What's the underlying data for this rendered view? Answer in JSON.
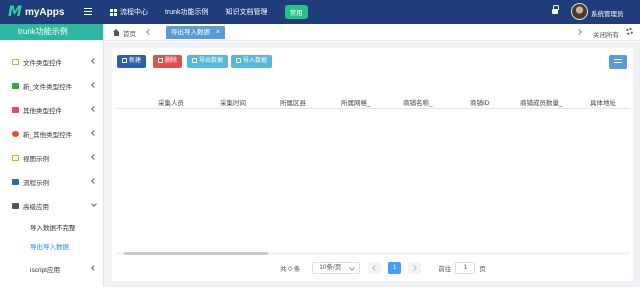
{
  "app": {
    "logo_mark": "M",
    "name": "myApps"
  },
  "topnav": {
    "items": [
      {
        "label": "流程中心"
      },
      {
        "label": "trunk功能示例"
      },
      {
        "label": "知识文档管理"
      },
      {
        "label": "常用"
      }
    ],
    "username": "系统管理员"
  },
  "sidebar": {
    "title": "trunk功能示例",
    "items": [
      {
        "label": "文件类型控件",
        "icon": "folder-icon",
        "color": "#8dc63f"
      },
      {
        "label": "新_文件类型控件",
        "icon": "folder-icon",
        "color": "#28a745"
      },
      {
        "label": "其他类型控件",
        "icon": "folder-icon",
        "color": "#e83e8c"
      },
      {
        "label": "新_其他类型控件",
        "icon": "cube-icon",
        "color": "#e74c3c"
      },
      {
        "label": "视图示例",
        "icon": "square-icon",
        "color": "#ff9800"
      },
      {
        "label": "流程示例",
        "icon": "shuffle-icon",
        "color": "#2d6ab5"
      },
      {
        "label": "高级应用",
        "icon": "grid-icon",
        "color": "#555555"
      }
    ],
    "subitems": [
      {
        "label": "导入数据不完整"
      },
      {
        "label": "导出导入数据"
      },
      {
        "label": "iscript应用"
      }
    ]
  },
  "tabs": {
    "home": "首页",
    "active": "导出导入数据",
    "close_all": "关闭所有"
  },
  "toolbar": {
    "new": "新建",
    "delete": "删除",
    "export": "导出数据",
    "import": "导入数据"
  },
  "table": {
    "columns": [
      "采集人员",
      "采集时间",
      "所属区县",
      "所属网格_",
      "商铺名称_",
      "商铺ID",
      "商铺成员数量_",
      "具体地址"
    ]
  },
  "pagination": {
    "total": "共 0 条",
    "page_size": "10条/页",
    "current": "1",
    "goto_label": "前往",
    "goto_value": "1",
    "page_suffix": "页"
  },
  "colors": {
    "topbar": "#1f3d7a",
    "accent": "#2fb7a0",
    "primary": "#409eff",
    "danger": "#d9534f"
  }
}
